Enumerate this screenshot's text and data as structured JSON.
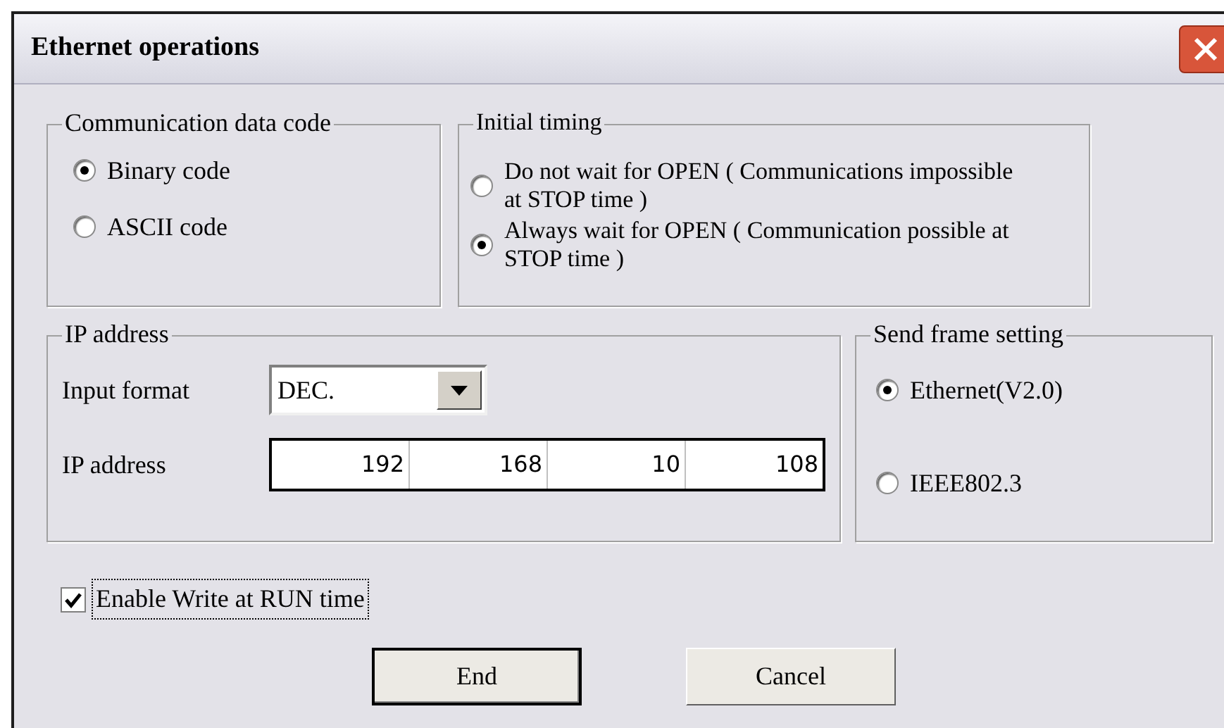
{
  "window": {
    "title": "Ethernet operations"
  },
  "data_code": {
    "title": "Communication data code",
    "options": [
      {
        "label": "Binary code",
        "selected": true
      },
      {
        "label": "ASCII code",
        "selected": false
      }
    ]
  },
  "initial_timing": {
    "title": "Initial timing",
    "options": [
      {
        "label": "Do not wait for OPEN ( Communications impossible at STOP time )",
        "selected": false
      },
      {
        "label": "Always wait for OPEN ( Communication possible at STOP time )",
        "selected": true
      }
    ]
  },
  "ip_address": {
    "title": "IP address",
    "input_format": {
      "label": "Input format",
      "value": "DEC."
    },
    "address": {
      "label": "IP address",
      "octets": [
        "192",
        "168",
        "10",
        "108"
      ]
    }
  },
  "send_frame": {
    "title": "Send frame setting",
    "options": [
      {
        "label": "Ethernet(V2.0)",
        "selected": true
      },
      {
        "label": "IEEE802.3",
        "selected": false
      }
    ]
  },
  "enable_write": {
    "label": "Enable Write at RUN time",
    "checked": true
  },
  "buttons": [
    {
      "label": "End",
      "default": true
    },
    {
      "label": "Cancel",
      "default": false
    }
  ]
}
